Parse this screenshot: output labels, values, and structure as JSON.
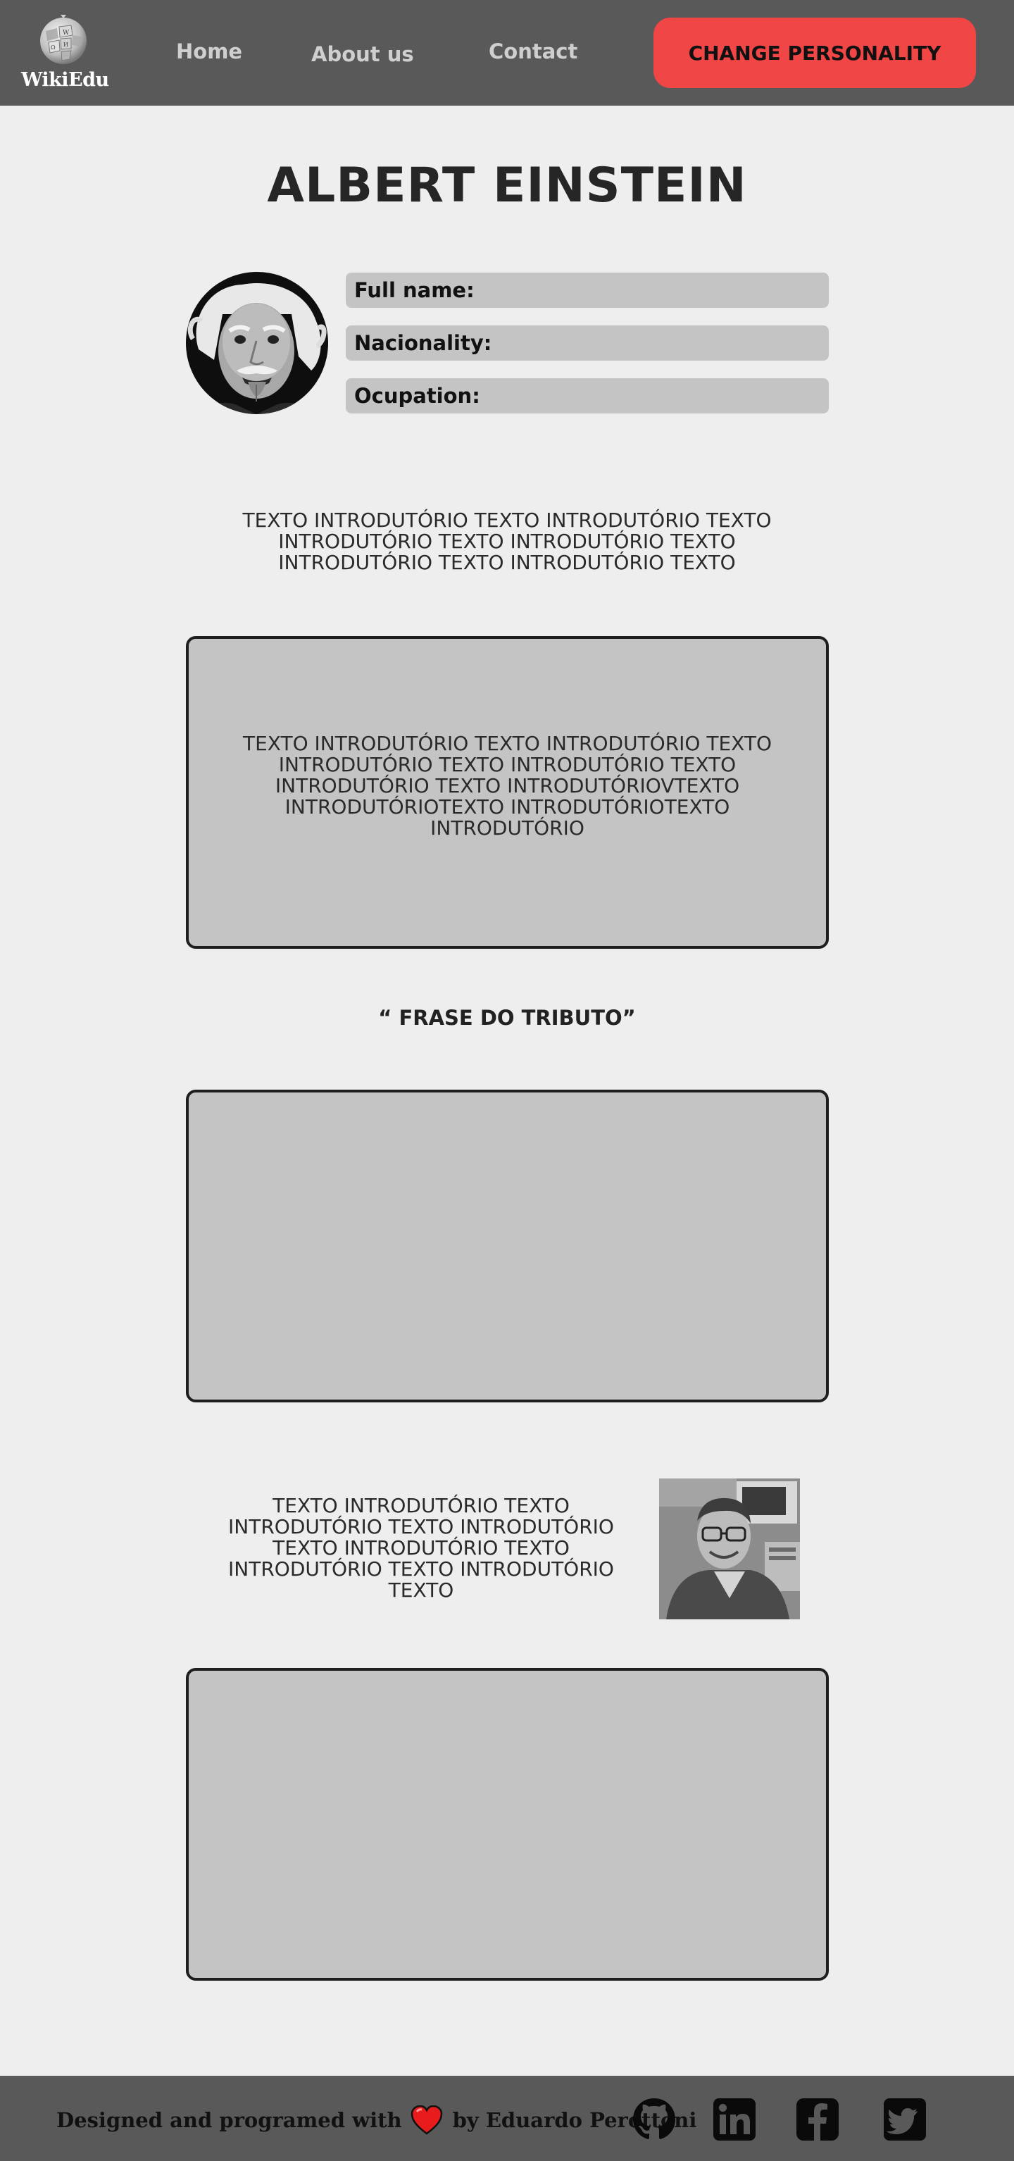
{
  "header": {
    "logo_text": "WikiEdu",
    "nav": {
      "home": "Home",
      "about": "About us",
      "contact": "Contact"
    },
    "cta_label": "CHANGE PERSONALITY"
  },
  "main": {
    "title": "ALBERT EINSTEIN",
    "fields": {
      "full_name": "Full name:",
      "nationality": "Nacionality:",
      "occupation": "Ocupation:"
    },
    "intro_text": "TEXTO INTRODUTÓRIO TEXTO INTRODUTÓRIO TEXTO INTRODUTÓRIO TEXTO INTRODUTÓRIO TEXTO INTRODUTÓRIO TEXTO INTRODUTÓRIO TEXTO",
    "panel_text": "TEXTO INTRODUTÓRIO TEXTO INTRODUTÓRIO TEXTO INTRODUTÓRIO TEXTO INTRODUTÓRIO TEXTO INTRODUTÓRIO TEXTO INTRODUTÓRIOVTEXTO INTRODUTÓRIOTEXTO INTRODUTÓRIOTEXTO INTRODUTÓRIO",
    "quote": "“ FRASE DO TRIBUTO”",
    "side_text": "TEXTO INTRODUTÓRIO TEXTO INTRODUTÓRIO TEXTO INTRODUTÓRIO TEXTO INTRODUTÓRIO TEXTO INTRODUTÓRIO TEXTO INTRODUTÓRIO TEXTO"
  },
  "footer": {
    "credit_before": "Designed and programed with",
    "credit_after": "by Eduardo Perottoni",
    "social": [
      "github-icon",
      "linkedin-icon",
      "facebook-icon",
      "twitter-icon"
    ]
  },
  "colors": {
    "header_bg": "#595959",
    "page_bg": "#eeeeee",
    "accent": "#f04646",
    "panel_bg": "#c4c4c4"
  }
}
